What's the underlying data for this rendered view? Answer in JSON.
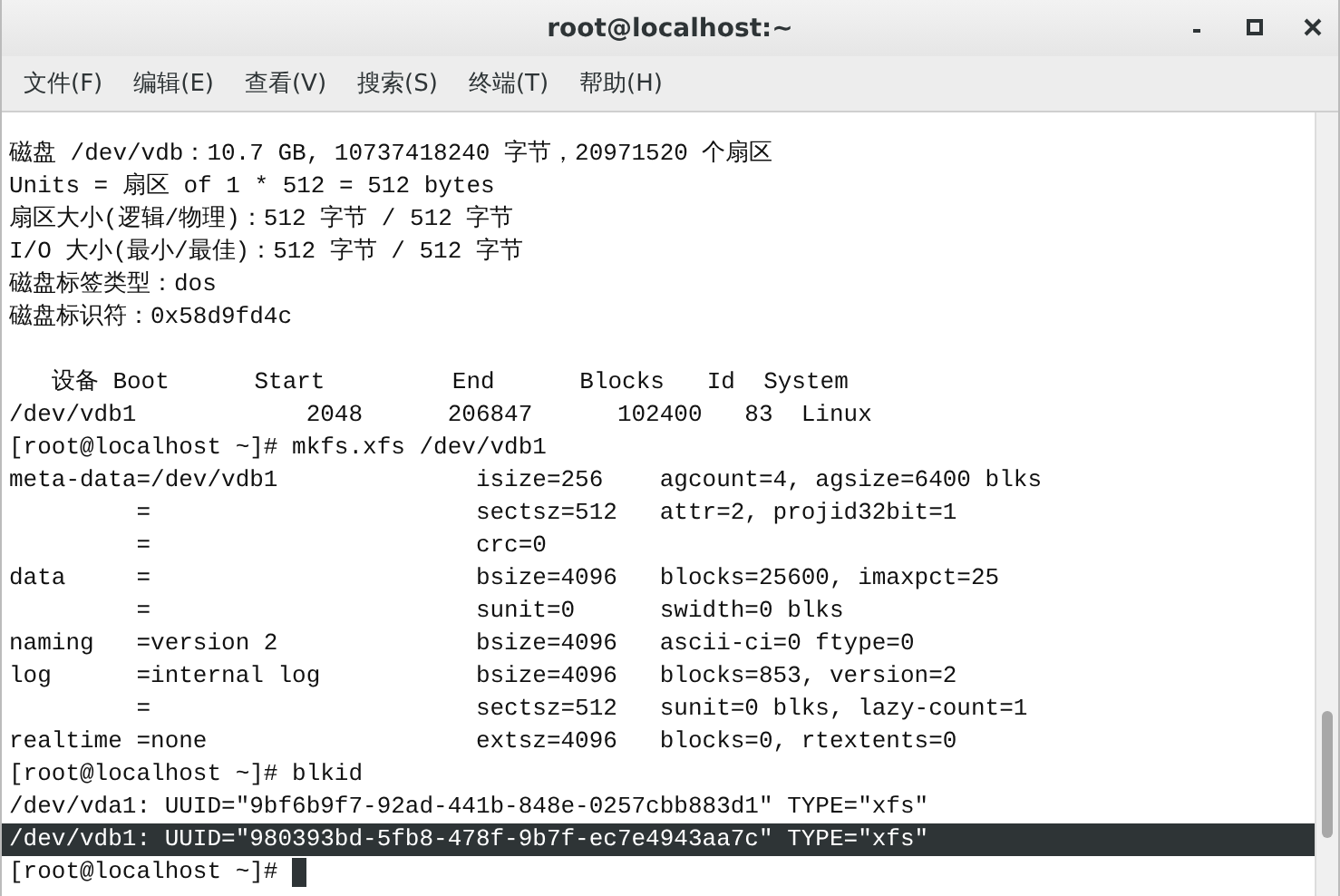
{
  "window": {
    "title": "root@localhost:~"
  },
  "menu": [
    "文件(F)",
    "编辑(E)",
    "查看(V)",
    "搜索(S)",
    "终端(T)",
    "帮助(H)"
  ],
  "terminal": {
    "lines": [
      {
        "kind": "text",
        "text": "磁盘 /dev/vdb：10.7 GB, 10737418240 字节，20971520 个扇区",
        "selected": false
      },
      {
        "kind": "text",
        "text": "Units = 扇区 of 1 * 512 = 512 bytes",
        "selected": false
      },
      {
        "kind": "text",
        "text": "扇区大小(逻辑/物理)：512 字节 / 512 字节",
        "selected": false
      },
      {
        "kind": "text",
        "text": "I/O 大小(最小/最佳)：512 字节 / 512 字节",
        "selected": false
      },
      {
        "kind": "text",
        "text": "磁盘标签类型：dos",
        "selected": false
      },
      {
        "kind": "text",
        "text": "磁盘标识符：0x58d9fd4c",
        "selected": false
      },
      {
        "kind": "blank"
      },
      {
        "kind": "text",
        "text": "   设备 Boot      Start         End      Blocks   Id  System",
        "selected": false
      },
      {
        "kind": "text",
        "text": "/dev/vdb1            2048      206847      102400   83  Linux",
        "selected": false
      },
      {
        "kind": "text",
        "text": "[root@localhost ~]# mkfs.xfs /dev/vdb1",
        "selected": false
      },
      {
        "kind": "text",
        "text": "meta-data=/dev/vdb1              isize=256    agcount=4, agsize=6400 blks",
        "selected": false
      },
      {
        "kind": "text",
        "text": "         =                       sectsz=512   attr=2, projid32bit=1",
        "selected": false
      },
      {
        "kind": "text",
        "text": "         =                       crc=0",
        "selected": false
      },
      {
        "kind": "text",
        "text": "data     =                       bsize=4096   blocks=25600, imaxpct=25",
        "selected": false
      },
      {
        "kind": "text",
        "text": "         =                       sunit=0      swidth=0 blks",
        "selected": false
      },
      {
        "kind": "text",
        "text": "naming   =version 2              bsize=4096   ascii-ci=0 ftype=0",
        "selected": false
      },
      {
        "kind": "text",
        "text": "log      =internal log           bsize=4096   blocks=853, version=2",
        "selected": false
      },
      {
        "kind": "text",
        "text": "         =                       sectsz=512   sunit=0 blks, lazy-count=1",
        "selected": false
      },
      {
        "kind": "text",
        "text": "realtime =none                   extsz=4096   blocks=0, rtextents=0",
        "selected": false
      },
      {
        "kind": "text",
        "text": "[root@localhost ~]# blkid",
        "selected": false
      },
      {
        "kind": "text",
        "text": "/dev/vda1: UUID=\"9bf6b9f7-92ad-441b-848e-0257cbb883d1\" TYPE=\"xfs\"",
        "selected": false
      },
      {
        "kind": "text",
        "text": "/dev/vdb1: UUID=\"980393bd-5fb8-478f-9b7f-ec7e4943aa7c\" TYPE=\"xfs\"",
        "selected": true
      },
      {
        "kind": "text",
        "text": "[root@localhost ~]#",
        "selected": false
      }
    ]
  }
}
